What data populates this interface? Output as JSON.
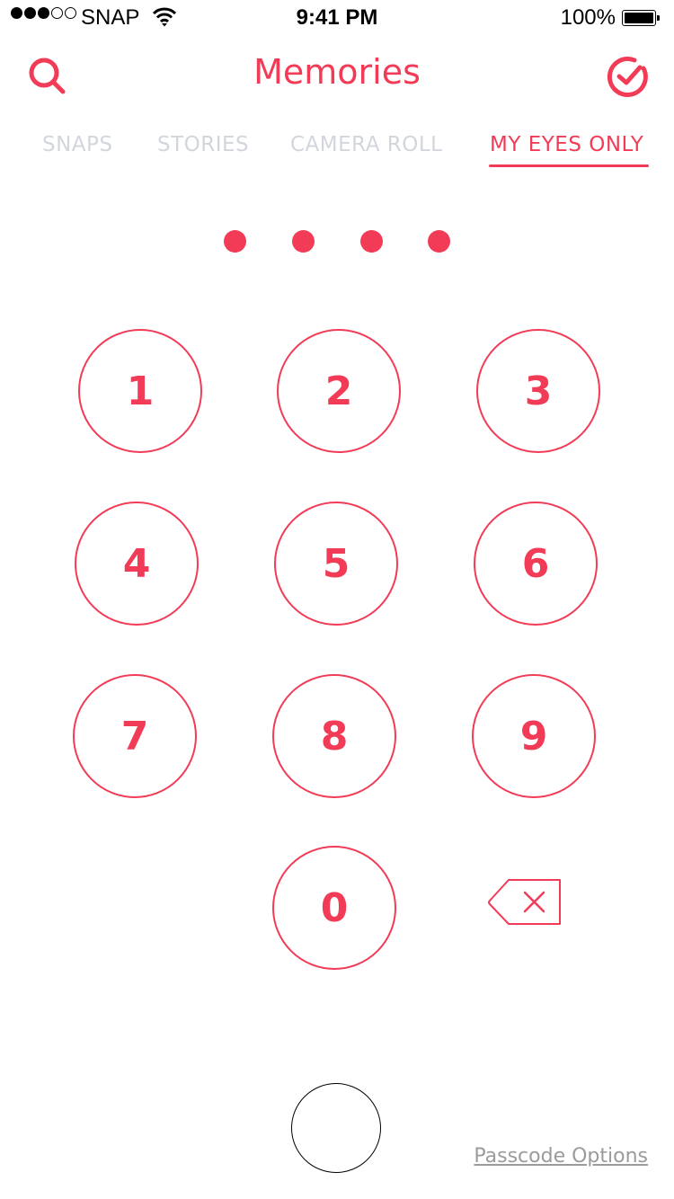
{
  "status_bar": {
    "signal_bars_filled": 3,
    "signal_bars_total": 5,
    "carrier": "SNAP",
    "time": "9:41 PM",
    "battery_percent": "100%",
    "battery_level": 1.0
  },
  "header": {
    "title": "Memories",
    "search_icon": "search-icon",
    "select_icon": "check-circle-icon"
  },
  "tabs": [
    {
      "label": "SNAPS",
      "active": false
    },
    {
      "label": "STORIES",
      "active": false
    },
    {
      "label": "CAMERA ROLL",
      "active": false
    },
    {
      "label": "MY EYES ONLY",
      "active": true
    }
  ],
  "passcode": {
    "digits_entered": 4,
    "digits_total": 4
  },
  "keypad": {
    "keys": [
      "1",
      "2",
      "3",
      "4",
      "5",
      "6",
      "7",
      "8",
      "9",
      "0"
    ],
    "backspace_icon": "backspace-icon"
  },
  "footer": {
    "passcode_options_label": "Passcode Options"
  },
  "colors": {
    "accent": "#f23c57",
    "tab_inactive": "#d2d6dc",
    "link_gray": "#9b9b9b"
  }
}
